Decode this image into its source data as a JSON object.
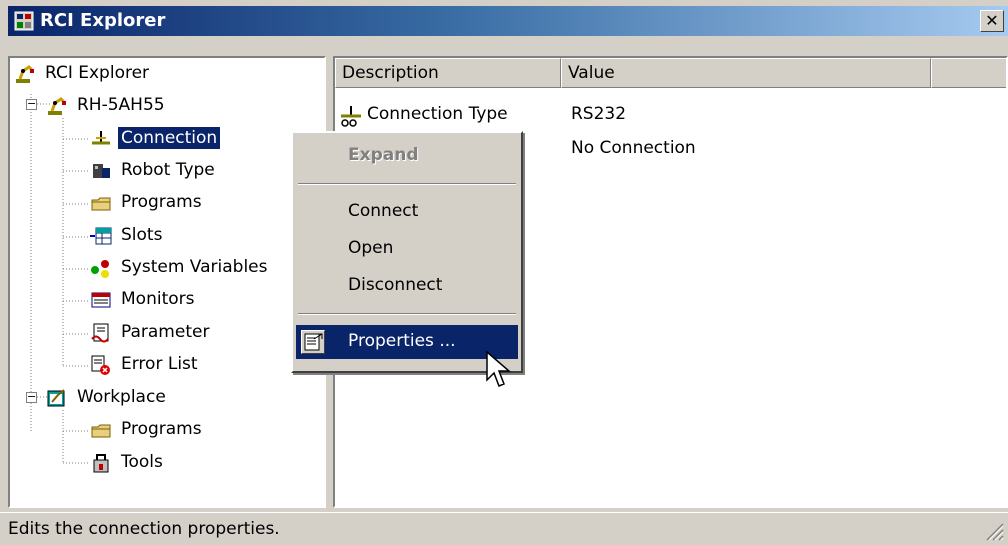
{
  "window": {
    "title": "RCI Explorer",
    "close_glyph": "✕"
  },
  "tree": {
    "root": {
      "label": "RCI Explorer",
      "icon": "robot-arm-icon"
    },
    "robot": {
      "label": "RH-5AH55",
      "expander": "⊟",
      "children": [
        {
          "label": "Connection",
          "icon": "connection-icon"
        },
        {
          "label": "Robot Type",
          "icon": "robot-type-icon"
        },
        {
          "label": "Programs",
          "icon": "folder-icon"
        },
        {
          "label": "Slots",
          "icon": "slots-icon"
        },
        {
          "label": "System Variables",
          "icon": "variables-icon"
        },
        {
          "label": "Monitors",
          "icon": "monitor-icon"
        },
        {
          "label": "Parameter",
          "icon": "parameter-icon"
        },
        {
          "label": "Error List",
          "icon": "error-list-icon"
        }
      ]
    },
    "workplace": {
      "label": "Workplace",
      "expander": "⊟",
      "children": [
        {
          "label": "Programs",
          "icon": "folder-icon"
        },
        {
          "label": "Tools",
          "icon": "tools-icon"
        }
      ]
    },
    "selected": "Connection"
  },
  "list": {
    "columns": [
      "Description",
      "Value"
    ],
    "rows": [
      {
        "description": "Connection Type",
        "value": "RS232",
        "icon": "connection-type-icon"
      },
      {
        "description": "",
        "value": "No Connection"
      }
    ]
  },
  "context_menu": {
    "items": [
      {
        "label": "Expand",
        "state": "disabled"
      },
      {
        "label": "Connect",
        "state": "normal"
      },
      {
        "label": "Open",
        "state": "normal"
      },
      {
        "label": "Disconnect",
        "state": "normal"
      },
      {
        "label": "Properties ...",
        "state": "highlighted",
        "icon": "properties-icon"
      }
    ]
  },
  "status_bar": {
    "text": "Edits the connection properties."
  },
  "colors": {
    "selection": "#0a246a",
    "title_start": "#0a246a",
    "title_end": "#a6caf0",
    "face": "#d4d0c8"
  }
}
